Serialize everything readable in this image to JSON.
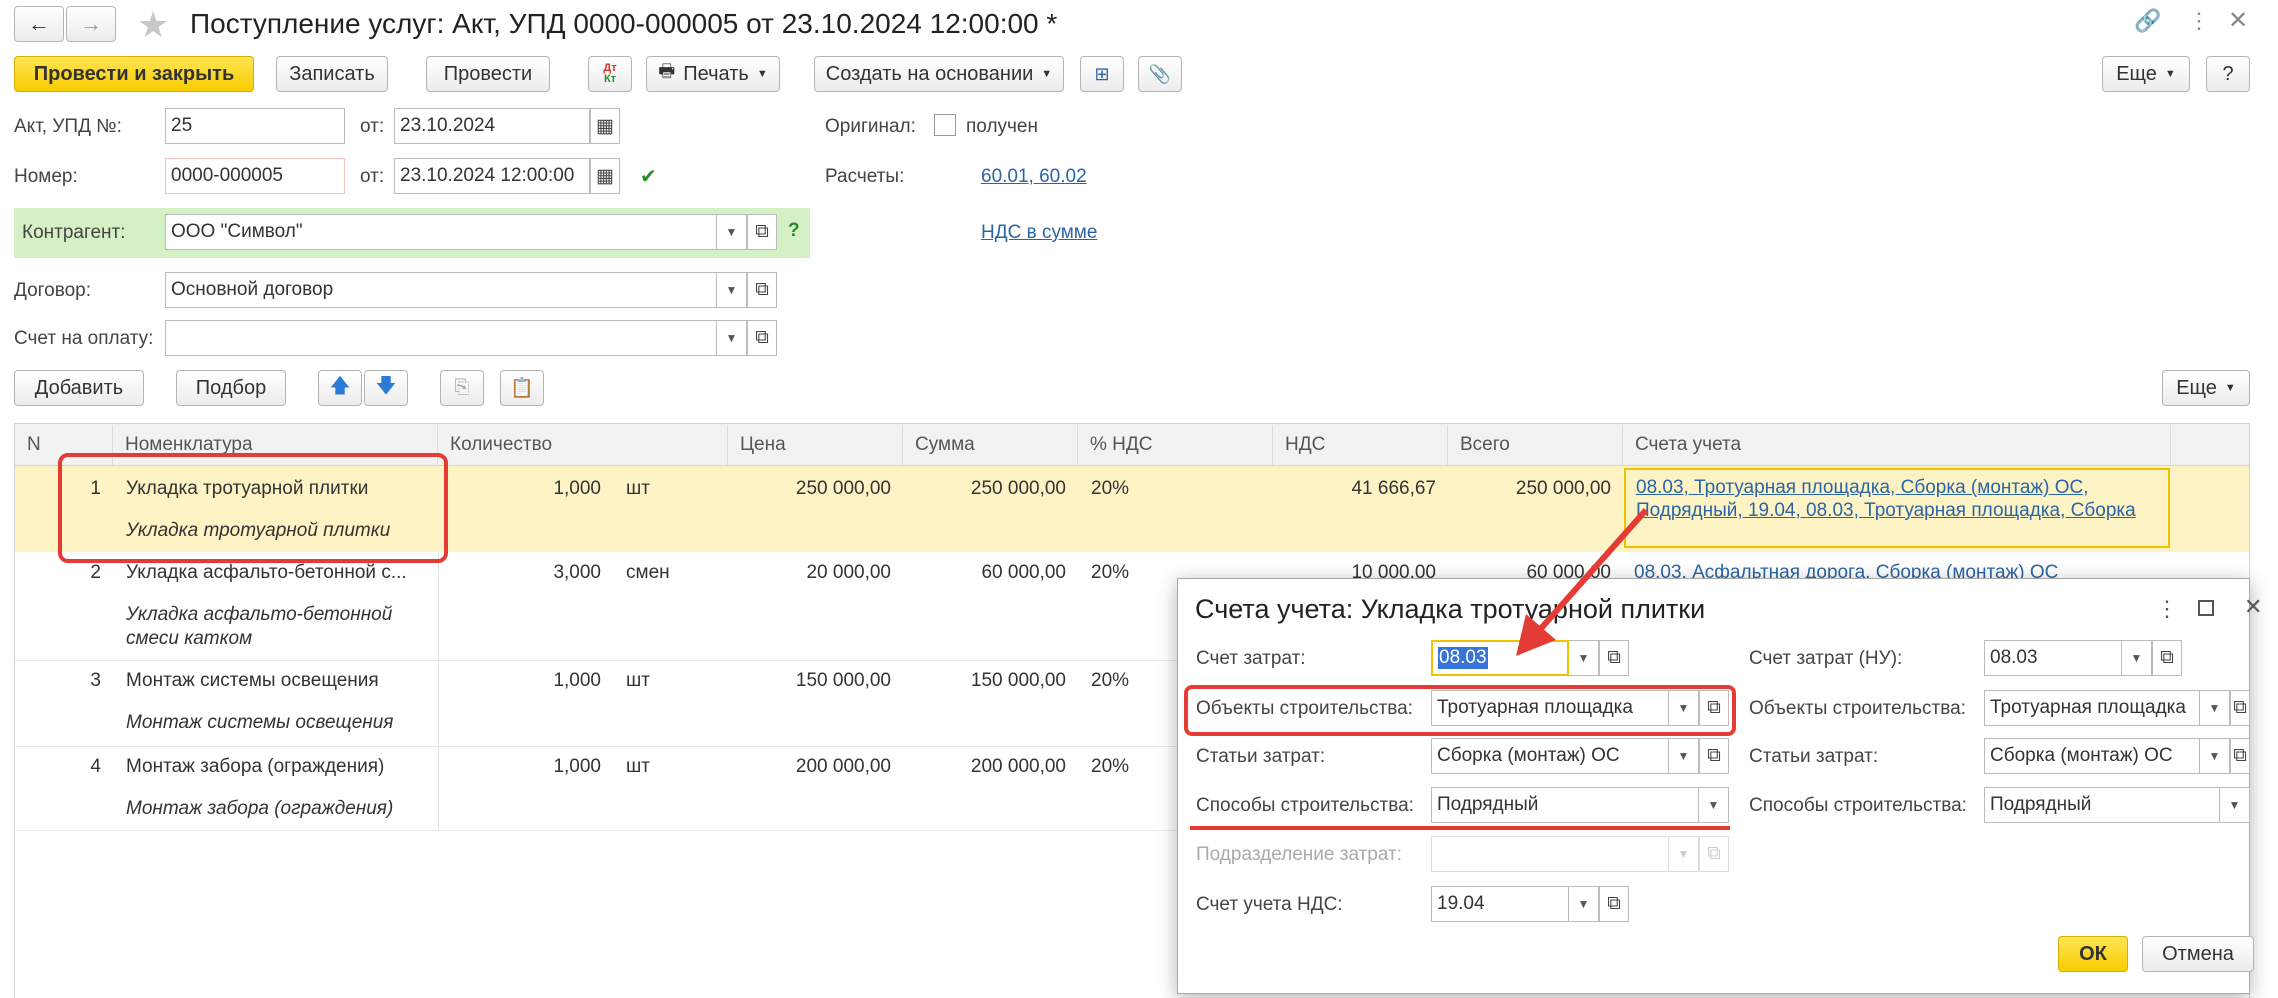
{
  "window": {
    "title": "Поступление услуг: Акт, УПД 0000-000005 от 23.10.2024 12:00:00 *"
  },
  "toolbar": {
    "post_close": "Провести и закрыть",
    "save": "Записать",
    "post": "Провести",
    "dt_kt": "Дт Кт",
    "print": "Печать",
    "create_based": "Создать на основании",
    "more": "Еще",
    "help": "?"
  },
  "form": {
    "act_label": "Акт, УПД №:",
    "act_value": "25",
    "from_label": "от:",
    "act_date": "23.10.2024",
    "number_label": "Номер:",
    "number_value": "0000-000005",
    "number_date": "23.10.2024 12:00:00",
    "original_label": "Оригинал:",
    "original_checkbox": "получен",
    "settlements_label": "Расчеты:",
    "settlements_link": "60.01, 60.02",
    "vat_link": "НДС в сумме",
    "counterparty_label": "Контрагент:",
    "counterparty_value": "ООО \"Символ\"",
    "contract_label": "Договор:",
    "contract_value": "Основной договор",
    "invoice_label": "Счет на оплату:",
    "invoice_value": ""
  },
  "table_toolbar": {
    "add": "Добавить",
    "select": "Подбор",
    "more": "Еще"
  },
  "table": {
    "columns": [
      "N",
      "Номенклатура",
      "Количество",
      "Цена",
      "Сумма",
      "% НДС",
      "НДС",
      "Всего",
      "Счета учета"
    ],
    "rows": [
      {
        "n": "1",
        "name": "Укладка тротуарной плитки",
        "sub": "Укладка тротуарной плитки",
        "qty": "1,000",
        "unit": "шт",
        "price": "250 000,00",
        "sum": "250 000,00",
        "vat_rate": "20%",
        "vat": "41 666,67",
        "total": "250 000,00",
        "acc1": "08.03, Тротуарная площадка, Сборка (монтаж) ОС,",
        "acc2": "Подрядный, 19.04, 08.03, Тротуарная площадка, Сборка"
      },
      {
        "n": "2",
        "name": "Укладка асфальто-бетонной с...",
        "sub": "Укладка асфальто-бетонной",
        "sub2": "смеси катком",
        "qty": "3,000",
        "unit": "смен",
        "price": "20 000,00",
        "sum": "60 000,00",
        "vat_rate": "20%",
        "vat": "10 000,00",
        "total": "60 000,00",
        "acc1": "08.03, Асфальтная дорога, Сборка (монтаж) ОС"
      },
      {
        "n": "3",
        "name": "Монтаж системы освещения",
        "sub": "Монтаж системы освещения",
        "qty": "1,000",
        "unit": "шт",
        "price": "150 000,00",
        "sum": "150 000,00",
        "vat_rate": "20%"
      },
      {
        "n": "4",
        "name": "Монтаж забора (ограждения)",
        "sub": "Монтаж забора (ограждения)",
        "qty": "1,000",
        "unit": "шт",
        "price": "200 000,00",
        "sum": "200 000,00",
        "vat_rate": "20%"
      }
    ]
  },
  "dialog": {
    "title": "Счета учета: Укладка тротуарной плитки",
    "cost_account_label": "Счет затрат:",
    "cost_account": "08.03",
    "cost_account_nu_label": "Счет затрат (НУ):",
    "cost_account_nu": "08.03",
    "objects_label": "Объекты строительства:",
    "objects": "Тротуарная площадка",
    "objects_nu": "Тротуарная площадка",
    "items_label": "Статьи затрат:",
    "items": "Сборка (монтаж) ОС",
    "items_nu": "Сборка (монтаж) ОС",
    "methods_label": "Способы строительства:",
    "methods": "Подрядный",
    "methods_nu": "Подрядный",
    "division_label": "Подразделение затрат:",
    "division": "",
    "vat_account_label": "Счет учета НДС:",
    "vat_account": "19.04",
    "ok": "ОК",
    "cancel": "Отмена"
  },
  "colors": {
    "accent_yellow": "#f7cd00",
    "highlight_row": "#fdf3c5",
    "green_field": "#d5f0c4",
    "annotation_red": "#e53b35",
    "link_blue": "#2a65a6"
  }
}
